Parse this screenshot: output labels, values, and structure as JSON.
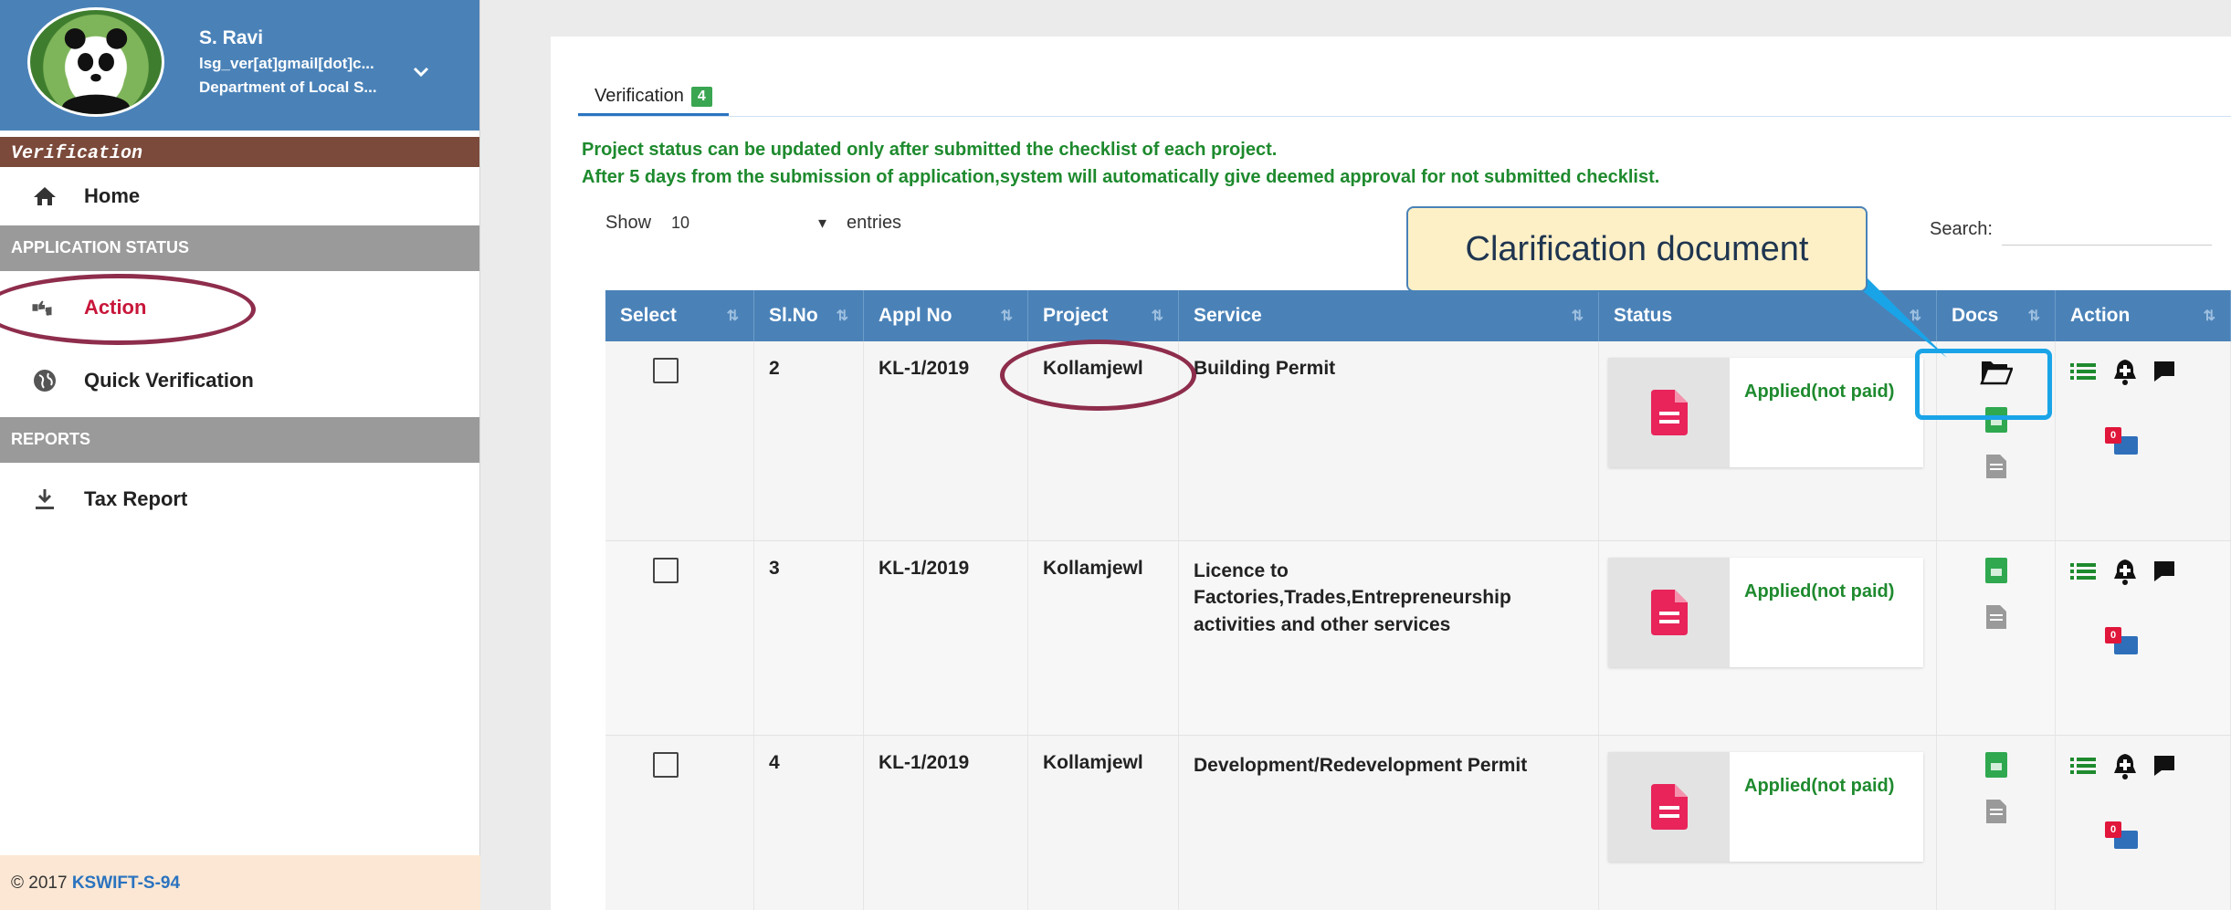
{
  "profile": {
    "name": "S. Ravi",
    "email": "lsg_ver[at]gmail[dot]c...",
    "department": "Department of Local S..."
  },
  "sidebar": {
    "section_title": "Verification",
    "home": "Home",
    "application_status_heading": "APPLICATION STATUS",
    "action": "Action",
    "quick_verification": "Quick Verification",
    "reports_heading": "REPORTS",
    "tax_report": "Tax Report"
  },
  "footer": {
    "copyright": "© 2017",
    "brand": "KSWIFT-S-94"
  },
  "tab": {
    "label": "Verification",
    "count": "4"
  },
  "notices": {
    "line1": "Project status can be updated only after submitted the checklist of each project.",
    "line2": "After 5 days from the submission of application,system will automatically give deemed approval for not submitted checklist."
  },
  "controls": {
    "show_label": "Show",
    "entries_value": "10",
    "entries_label": "entries",
    "search_label": "Search:"
  },
  "table": {
    "headers": [
      "Select",
      "Sl.No",
      "Appl No",
      "Project",
      "Service",
      "Status",
      "Docs",
      "Action"
    ],
    "rows": [
      {
        "slno": "2",
        "appl_no": "KL-1/2019",
        "project": "Kollamjewl",
        "service": "Building Permit",
        "status": "Applied(not paid)",
        "badge": "0"
      },
      {
        "slno": "3",
        "appl_no": "KL-1/2019",
        "project": "Kollamjewl",
        "service": "Licence to Factories,Trades,Entrepreneurship activities and other services",
        "status": "Applied(not paid)",
        "badge": "0"
      },
      {
        "slno": "4",
        "appl_no": "KL-1/2019",
        "project": "Kollamjewl",
        "service": "Development/Redevelopment Permit",
        "status": "Applied(not paid)",
        "badge": "0"
      }
    ]
  },
  "annotation": {
    "callout": "Clarification document"
  },
  "colors": {
    "primary": "#4a82b8",
    "accent_red": "#c8163a",
    "status_green": "#1e8a2e",
    "callout_border": "#1aa4e8",
    "ring": "#8e2d4c"
  }
}
